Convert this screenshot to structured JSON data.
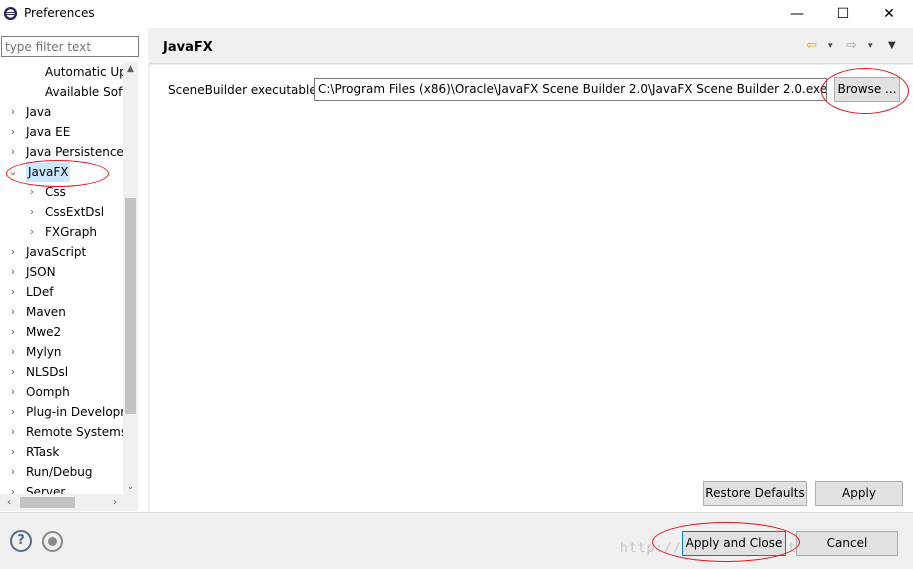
{
  "window": {
    "title": "Preferences",
    "controls": {
      "minimize": "—",
      "maximize": "☐",
      "close": "✕"
    }
  },
  "left_panel": {
    "filter_placeholder": "type filter text",
    "tree": [
      {
        "label": "Automatic Up",
        "arrow": "",
        "indent": 2
      },
      {
        "label": "Available Soft",
        "arrow": "",
        "indent": 2
      },
      {
        "label": "Java",
        "arrow": "›",
        "indent": 1
      },
      {
        "label": "Java EE",
        "arrow": "›",
        "indent": 1
      },
      {
        "label": "Java Persistence",
        "arrow": "›",
        "indent": 1
      },
      {
        "label": "JavaFX",
        "arrow": "⌄",
        "indent": 1,
        "selected": true
      },
      {
        "label": "Css",
        "arrow": "›",
        "indent": 2
      },
      {
        "label": "CssExtDsl",
        "arrow": "›",
        "indent": 2
      },
      {
        "label": "FXGraph",
        "arrow": "›",
        "indent": 2
      },
      {
        "label": "JavaScript",
        "arrow": "›",
        "indent": 1
      },
      {
        "label": "JSON",
        "arrow": "›",
        "indent": 1
      },
      {
        "label": "LDef",
        "arrow": "›",
        "indent": 1
      },
      {
        "label": "Maven",
        "arrow": "›",
        "indent": 1
      },
      {
        "label": "Mwe2",
        "arrow": "›",
        "indent": 1
      },
      {
        "label": "Mylyn",
        "arrow": "›",
        "indent": 1
      },
      {
        "label": "NLSDsl",
        "arrow": "›",
        "indent": 1
      },
      {
        "label": "Oomph",
        "arrow": "›",
        "indent": 1
      },
      {
        "label": "Plug-in Developr",
        "arrow": "›",
        "indent": 1
      },
      {
        "label": "Remote Systems",
        "arrow": "›",
        "indent": 1
      },
      {
        "label": "RTask",
        "arrow": "›",
        "indent": 1
      },
      {
        "label": "Run/Debug",
        "arrow": "›",
        "indent": 1
      },
      {
        "label": "Server",
        "arrow": "›",
        "indent": 1
      }
    ]
  },
  "right_panel": {
    "page_title": "JavaFX",
    "nav": {
      "back": "⇦",
      "forward": "⇨",
      "dropdown": "▾",
      "menu": "▼"
    },
    "scenebuilder_label": "SceneBuilder executable",
    "scenebuilder_path": "C:\\Program Files (x86)\\Oracle\\JavaFX Scene Builder 2.0\\JavaFX Scene Builder 2.0.exe",
    "browse_label": "Browse ...",
    "restore_defaults_label": "Restore Defaults",
    "apply_label": "Apply"
  },
  "bottom_bar": {
    "help_label": "?",
    "apply_close_label": "Apply and Close",
    "cancel_label": "Cancel",
    "watermark": "http://blog.csdn.net/nomiel"
  },
  "colors": {
    "annotation": "#e0141e",
    "selected_bg": "#cce8ff",
    "focus_border": "#0078d7"
  }
}
